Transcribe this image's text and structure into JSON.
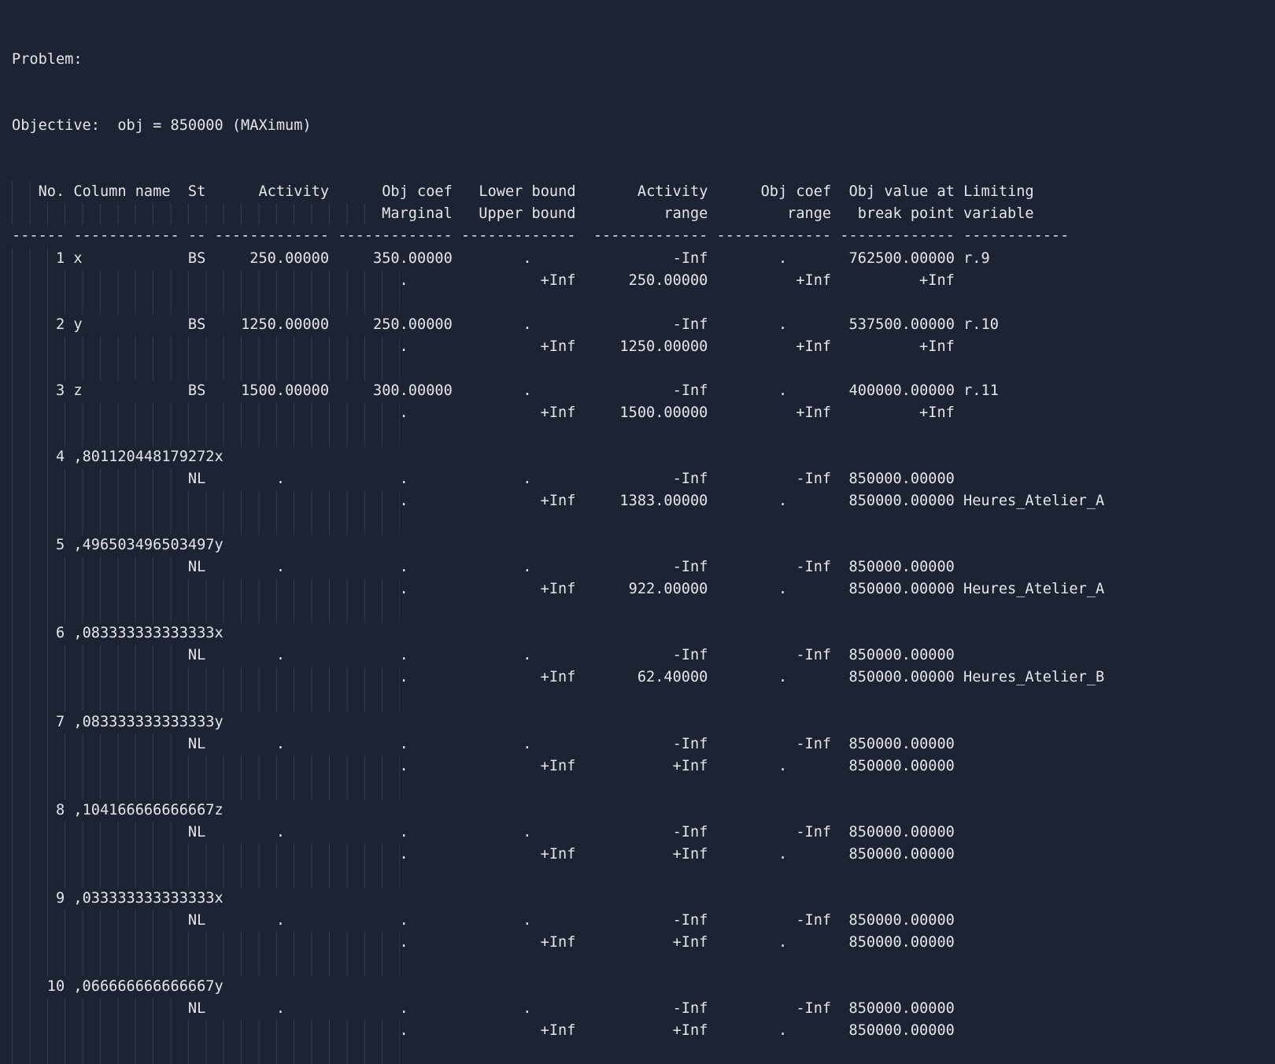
{
  "problem_label": "Problem:",
  "objective_line": "Objective:  obj = 850000 (MAXimum)",
  "header": {
    "line1": [
      "No.",
      "Column name",
      "St",
      "Activity",
      "Obj coef",
      "Lower bound",
      "Activity",
      "Obj coef",
      "Obj value at",
      "Limiting"
    ],
    "line2": [
      "",
      "",
      "",
      "",
      "Marginal",
      "Upper bound",
      "range",
      "range",
      "break point",
      "variable"
    ]
  },
  "rows": [
    {
      "no": "1",
      "name": "x",
      "st": "BS",
      "activity": "250.00000",
      "obj_coef": "350.00000",
      "lower_bound": ".",
      "act_range_lo": "-Inf",
      "obj_range_lo": ".",
      "obj_val_lo": "762500.00000",
      "limiting_lo": "r.9",
      "marginal": ".",
      "upper_bound": "+Inf",
      "act_range_hi": "250.00000",
      "obj_range_hi": "+Inf",
      "obj_val_hi": "+Inf",
      "limiting_hi": ""
    },
    {
      "no": "2",
      "name": "y",
      "st": "BS",
      "activity": "1250.00000",
      "obj_coef": "250.00000",
      "lower_bound": ".",
      "act_range_lo": "-Inf",
      "obj_range_lo": ".",
      "obj_val_lo": "537500.00000",
      "limiting_lo": "r.10",
      "marginal": ".",
      "upper_bound": "+Inf",
      "act_range_hi": "1250.00000",
      "obj_range_hi": "+Inf",
      "obj_val_hi": "+Inf",
      "limiting_hi": ""
    },
    {
      "no": "3",
      "name": "z",
      "st": "BS",
      "activity": "1500.00000",
      "obj_coef": "300.00000",
      "lower_bound": ".",
      "act_range_lo": "-Inf",
      "obj_range_lo": ".",
      "obj_val_lo": "400000.00000",
      "limiting_lo": "r.11",
      "marginal": ".",
      "upper_bound": "+Inf",
      "act_range_hi": "1500.00000",
      "obj_range_hi": "+Inf",
      "obj_val_hi": "+Inf",
      "limiting_hi": ""
    },
    {
      "no": "4",
      "name": ",801120448179272x",
      "st": "NL",
      "activity": ".",
      "obj_coef": ".",
      "lower_bound": ".",
      "act_range_lo": "-Inf",
      "obj_range_lo": "-Inf",
      "obj_val_lo": "850000.00000",
      "limiting_lo": "",
      "marginal": ".",
      "upper_bound": "+Inf",
      "act_range_hi": "1383.00000",
      "obj_range_hi": ".",
      "obj_val_hi": "850000.00000",
      "limiting_hi": "Heures_Atelier_A"
    },
    {
      "no": "5",
      "name": ",496503496503497y",
      "st": "NL",
      "activity": ".",
      "obj_coef": ".",
      "lower_bound": ".",
      "act_range_lo": "-Inf",
      "obj_range_lo": "-Inf",
      "obj_val_lo": "850000.00000",
      "limiting_lo": "",
      "marginal": ".",
      "upper_bound": "+Inf",
      "act_range_hi": "922.00000",
      "obj_range_hi": ".",
      "obj_val_hi": "850000.00000",
      "limiting_hi": "Heures_Atelier_A"
    },
    {
      "no": "6",
      "name": ",083333333333333x",
      "st": "NL",
      "activity": ".",
      "obj_coef": ".",
      "lower_bound": ".",
      "act_range_lo": "-Inf",
      "obj_range_lo": "-Inf",
      "obj_val_lo": "850000.00000",
      "limiting_lo": "",
      "marginal": ".",
      "upper_bound": "+Inf",
      "act_range_hi": "62.40000",
      "obj_range_hi": ".",
      "obj_val_hi": "850000.00000",
      "limiting_hi": "Heures_Atelier_B"
    },
    {
      "no": "7",
      "name": ",083333333333333y",
      "st": "NL",
      "activity": ".",
      "obj_coef": ".",
      "lower_bound": ".",
      "act_range_lo": "-Inf",
      "obj_range_lo": "-Inf",
      "obj_val_lo": "850000.00000",
      "limiting_lo": "",
      "marginal": ".",
      "upper_bound": "+Inf",
      "act_range_hi": "+Inf",
      "obj_range_hi": ".",
      "obj_val_hi": "850000.00000",
      "limiting_hi": ""
    },
    {
      "no": "8",
      "name": ",104166666666667z",
      "st": "NL",
      "activity": ".",
      "obj_coef": ".",
      "lower_bound": ".",
      "act_range_lo": "-Inf",
      "obj_range_lo": "-Inf",
      "obj_val_lo": "850000.00000",
      "limiting_lo": "",
      "marginal": ".",
      "upper_bound": "+Inf",
      "act_range_hi": "+Inf",
      "obj_range_hi": ".",
      "obj_val_hi": "850000.00000",
      "limiting_hi": ""
    },
    {
      "no": "9",
      "name": ",033333333333333x",
      "st": "NL",
      "activity": ".",
      "obj_coef": ".",
      "lower_bound": ".",
      "act_range_lo": "-Inf",
      "obj_range_lo": "-Inf",
      "obj_val_lo": "850000.00000",
      "limiting_lo": "",
      "marginal": ".",
      "upper_bound": "+Inf",
      "act_range_hi": "+Inf",
      "obj_range_hi": ".",
      "obj_val_hi": "850000.00000",
      "limiting_hi": ""
    },
    {
      "no": "10",
      "name": ",066666666666667y",
      "st": "NL",
      "activity": ".",
      "obj_coef": ".",
      "lower_bound": ".",
      "act_range_lo": "-Inf",
      "obj_range_lo": "-Inf",
      "obj_val_lo": "850000.00000",
      "limiting_lo": "",
      "marginal": ".",
      "upper_bound": "+Inf",
      "act_range_hi": "+Inf",
      "obj_range_hi": ".",
      "obj_val_hi": "850000.00000",
      "limiting_hi": ""
    }
  ]
}
